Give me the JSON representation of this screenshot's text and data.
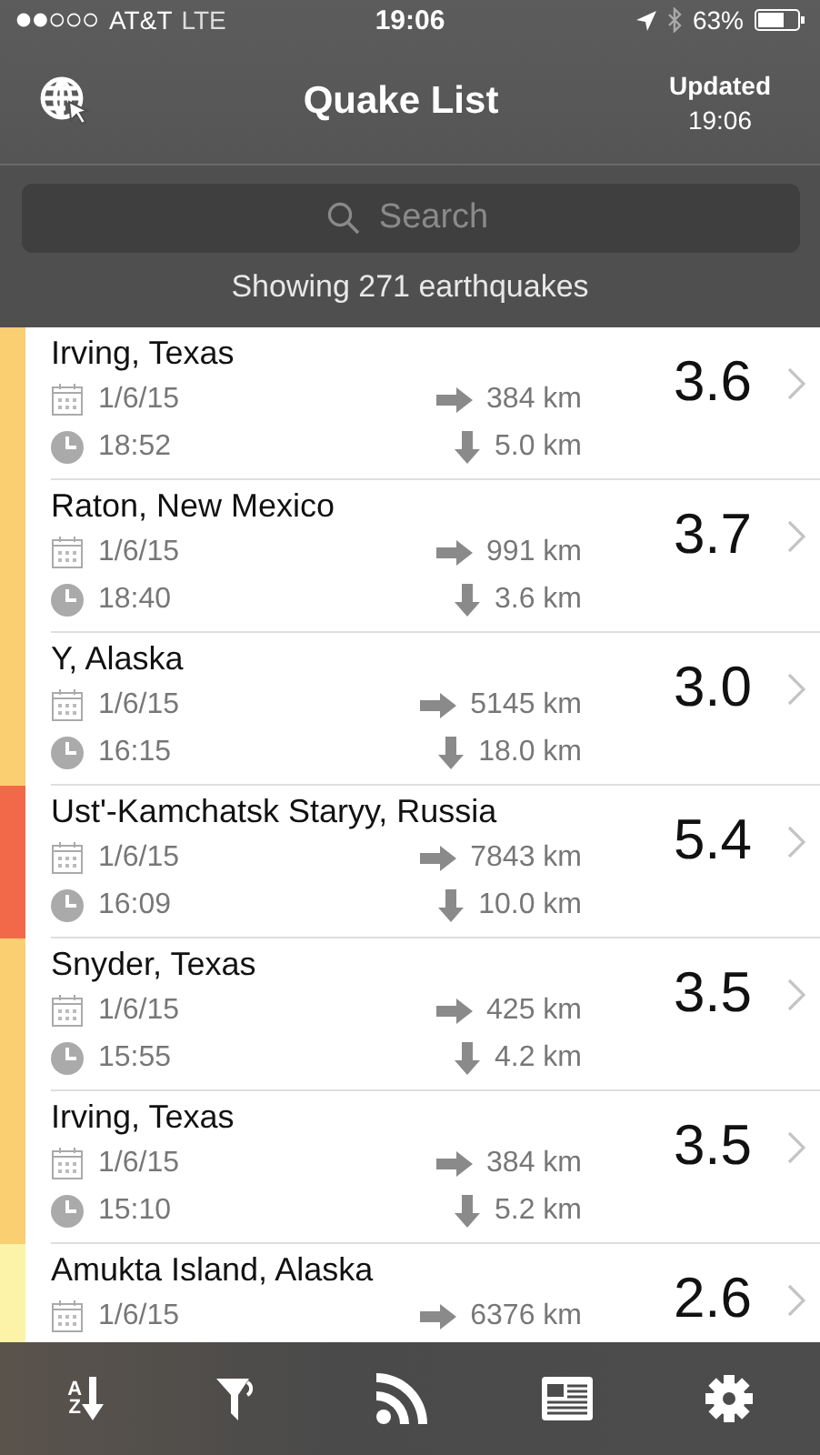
{
  "status_bar": {
    "carrier": "AT&T",
    "network": "LTE",
    "time": "19:06",
    "battery": "63%"
  },
  "nav": {
    "title": "Quake List",
    "updated_label": "Updated",
    "updated_time": "19:06"
  },
  "search": {
    "placeholder": "Search"
  },
  "summary": "Showing 271 earthquakes",
  "quakes": [
    {
      "place": "Irving, Texas",
      "date": "1/6/15",
      "time": "18:52",
      "distance": "384 km",
      "depth": "5.0 km",
      "magnitude": "3.6",
      "color": "#f9cf71"
    },
    {
      "place": "Raton, New Mexico",
      "date": "1/6/15",
      "time": "18:40",
      "distance": "991 km",
      "depth": "3.6 km",
      "magnitude": "3.7",
      "color": "#f9cf71"
    },
    {
      "place": "Y, Alaska",
      "date": "1/6/15",
      "time": "16:15",
      "distance": "5145 km",
      "depth": "18.0 km",
      "magnitude": "3.0",
      "color": "#f9cf71"
    },
    {
      "place": "Ust'-Kamchatsk Staryy, Russia",
      "date": "1/6/15",
      "time": "16:09",
      "distance": "7843 km",
      "depth": "10.0 km",
      "magnitude": "5.4",
      "color": "#f2694a"
    },
    {
      "place": "Snyder, Texas",
      "date": "1/6/15",
      "time": "15:55",
      "distance": "425 km",
      "depth": "4.2 km",
      "magnitude": "3.5",
      "color": "#f9cf71"
    },
    {
      "place": "Irving, Texas",
      "date": "1/6/15",
      "time": "15:10",
      "distance": "384 km",
      "depth": "5.2 km",
      "magnitude": "3.5",
      "color": "#f9cf71"
    },
    {
      "place": "Amukta Island, Alaska",
      "date": "1/6/15",
      "distance": "6376 km",
      "magnitude": "2.6",
      "color": "#fdf3a8"
    }
  ],
  "tab_bar": [
    {
      "kind": "sort",
      "letters": [
        "A",
        "Z"
      ]
    },
    {
      "kind": "filter"
    },
    {
      "kind": "feed"
    },
    {
      "kind": "news"
    },
    {
      "kind": "settings"
    }
  ]
}
